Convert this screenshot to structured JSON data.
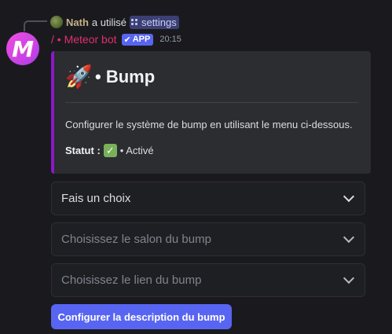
{
  "reply": {
    "user_name": "Nath",
    "action_text": "a utilisé",
    "command_name": "settings"
  },
  "message": {
    "avatar_letter": "M",
    "author_prefix": "/ •",
    "author_name": "Meteor bot",
    "app_badge": "APP",
    "timestamp": "20:15"
  },
  "embed": {
    "accent_color": "#8b18c9",
    "icon": "rocket-icon",
    "title": "• Bump",
    "description": "Configurer le système de bump en utilisant le menu ci-dessous.",
    "status_label": "Statut :",
    "status_value": "• Activé"
  },
  "components": {
    "select_main": {
      "placeholder": "Fais un choix"
    },
    "select_channel": {
      "placeholder": "Choisissez le salon du bump"
    },
    "select_link": {
      "placeholder": "Choisissez le lien du bump"
    },
    "button_label": "Configurer la description du bump"
  },
  "colors": {
    "background": "#1a1a1e",
    "embed_bg": "#2b2d31",
    "author_color": "#e0306a",
    "button_color": "#5865f2"
  }
}
